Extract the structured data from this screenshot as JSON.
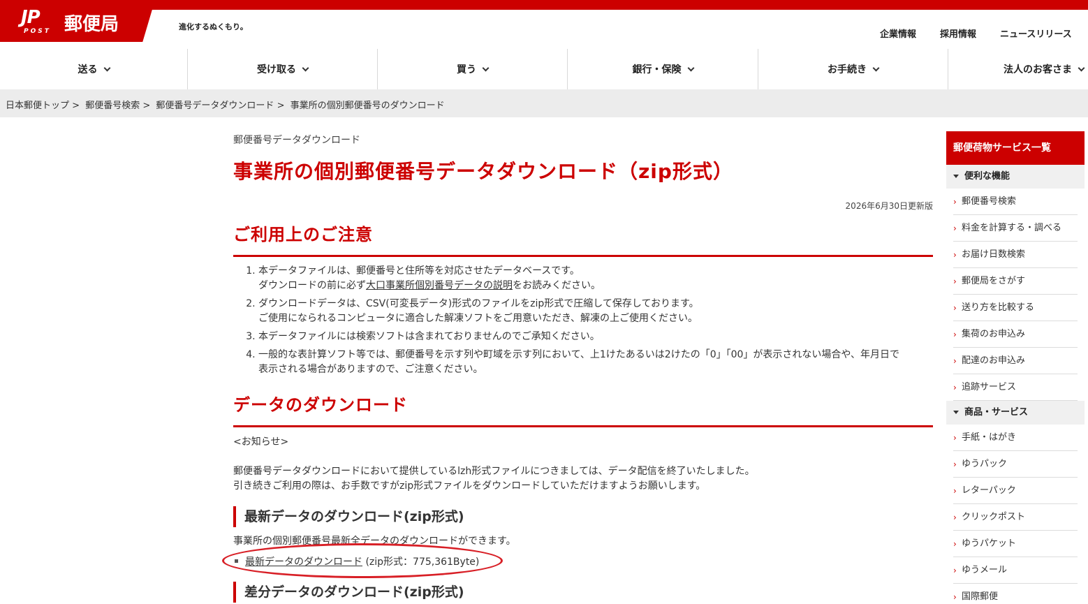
{
  "header": {
    "logo_jp": "JP",
    "logo_post": "POST",
    "logo_name": "郵便局",
    "tagline": "進化するぬくもり。",
    "utility_links": [
      "企業情報",
      "採用情報",
      "ニュースリリース"
    ]
  },
  "global_nav": [
    {
      "label": "送る"
    },
    {
      "label": "受け取る"
    },
    {
      "label": "買う"
    },
    {
      "label": "銀行・保険"
    },
    {
      "label": "お手続き"
    },
    {
      "label": "法人のお客さま"
    }
  ],
  "breadcrumb": {
    "items": [
      "日本郵便トップ",
      "郵便番号検索",
      "郵便番号データダウンロード",
      "事業所の個別郵便番号のダウンロード"
    ],
    "separator": ">"
  },
  "main": {
    "category": "郵便番号データダウンロード",
    "title": "事業所の個別郵便番号データダウンロード（zip形式）",
    "updated": "2026年6月30日更新版",
    "notice_heading": "ご利用上のご注意",
    "notes": [
      {
        "line1": "本データファイルは、郵便番号と住所等を対応させたデータベースです。",
        "line2_pre": "ダウンロードの前に必ず",
        "line2_link": "大口事業所個別番号データの説明",
        "line2_post": "をお読みください。"
      },
      {
        "line1": "ダウンロードデータは、CSV(可変長データ)形式のファイルをzip形式で圧縮して保存しております。",
        "line2": "ご使用になられるコンピュータに適合した解凍ソフトをご用意いただき、解凍の上ご使用ください。"
      },
      {
        "line1": "本データファイルには検索ソフトは含まれておりませんのでご承知ください。"
      },
      {
        "line1": "一般的な表計算ソフト等では、郵便番号を示す列や町域を示す列において、上1けたあるいは2けたの「0」「00」が表示されない場合や、年月日で",
        "line2": "表示される場合がありますので、ご注意ください。"
      }
    ],
    "download_heading": "データのダウンロード",
    "notice_label": "<お知らせ>",
    "notice_text1": "郵便番号データダウンロードにおいて提供しているlzh形式ファイルにつきましては、データ配信を終了いたしました。",
    "notice_text2": "引き続きご利用の際は、お手数ですがzip形式ファイルをダウンロードしていただけますようお願いします。",
    "latest_heading": "最新データのダウンロード(zip形式)",
    "latest_desc": "事業所の個別郵便番号最新全データのダウンロードができます。",
    "latest_link": "最新データのダウンロード",
    "latest_size": "(zip形式：775,361Byte)",
    "diff_heading": "差分データのダウンロード(zip形式)"
  },
  "sidebar": {
    "title": "郵便荷物サービス一覧",
    "sections": [
      {
        "label": "便利な機能",
        "links": [
          "郵便番号検索",
          "料金を計算する・調べる",
          "お届け日数検索",
          "郵便局をさがす",
          "送り方を比較する",
          "集荷のお申込み",
          "配達のお申込み",
          "追跡サービス"
        ]
      },
      {
        "label": "商品・サービス",
        "links": [
          "手紙・はがき",
          "ゆうパック",
          "レターパック",
          "クリックポスト",
          "ゆうパケット",
          "ゆうメール",
          "国際郵便"
        ]
      }
    ]
  },
  "colors": {
    "brand": "#cc0000",
    "annotation": "#d81f26"
  }
}
